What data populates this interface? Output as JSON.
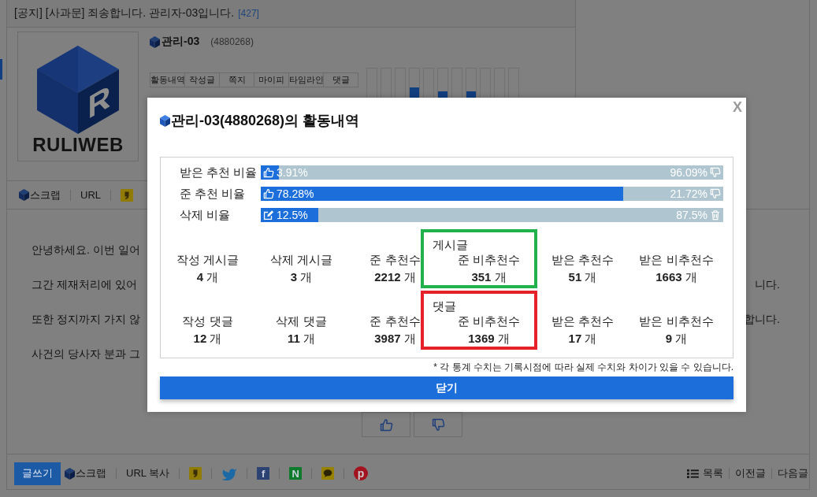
{
  "page": {
    "title": {
      "text": "[공지] [사과문] 죄송합니다. 관리자-03입니다.",
      "count": "[427]"
    },
    "profile": {
      "logo": {
        "mark": "R",
        "wordmark": "RULIWEB"
      },
      "name": "관리-03",
      "member_id": "(4880268)",
      "tabs": [
        {
          "label": "활동내역"
        },
        {
          "label": "작성글"
        },
        {
          "label": "쪽지"
        },
        {
          "label": "마이피"
        },
        {
          "label": "타임라인"
        },
        {
          "label": "댓글"
        }
      ]
    },
    "share_bar": [
      {
        "kind": "scrap",
        "label": "스크랩"
      },
      {
        "kind": "link",
        "label": "URL"
      },
      {
        "kind": "quote_tile",
        "color": "#8f7b05"
      }
    ],
    "body_lines": [
      {
        "left": "안녕하세요. 이번 일어"
      },
      {
        "left": "그간 제재처리에 있어",
        "right": "니다."
      },
      {
        "left": "또한 정지까지 가지 않",
        "right": "합니다."
      },
      {
        "left": "사건의 당사자 분과 그"
      }
    ],
    "vote_buttons": [
      {
        "kind": "up"
      },
      {
        "kind": "down"
      }
    ],
    "bottom_bar": {
      "write_button": "글쓰기",
      "share": [
        {
          "kind": "scrap",
          "label": "스크랩"
        },
        {
          "kind": "link",
          "label": "URL 복사"
        },
        {
          "kind": "quote_tile",
          "color": "#8f7b05"
        },
        {
          "kind": "bird",
          "color": "#1b6aa5"
        },
        {
          "kind": "letter_tile",
          "glyph": "f",
          "color": "#2c4272"
        },
        {
          "kind": "letter_tile",
          "glyph": "N",
          "color": "#0e7a2b"
        },
        {
          "kind": "bubble_tile",
          "color": "#968200"
        },
        {
          "kind": "letter_circle",
          "glyph": "p",
          "color": "#a2131f"
        }
      ],
      "nav": [
        {
          "kind": "list",
          "label": "목록"
        },
        {
          "kind": "link",
          "label": "이전글"
        },
        {
          "kind": "link",
          "label": "다음글"
        }
      ]
    }
  },
  "modal": {
    "title": "관리-03(4880268)의 활동내역",
    "close": "X",
    "bars": [
      {
        "kind": "vote",
        "label": "받은 추천 비율",
        "level": 0.0391,
        "left_text": "3.91%",
        "right_text": "96.09%"
      },
      {
        "kind": "vote",
        "label": "준 추천 비율",
        "level": 0.7828,
        "left_text": "78.28%",
        "right_text": "21.72%"
      },
      {
        "kind": "delete",
        "label": "삭제 비율",
        "level": 0.125,
        "left_text": "12.5%",
        "right_text": "87.5%"
      }
    ],
    "stat_rows": [
      {
        "group_label": "게시글",
        "color": "#21b24b",
        "items": [
          {
            "label": "작성 게시글",
            "value": "**4** 개",
            "highlighted": false
          },
          {
            "label": "삭제 게시글",
            "value": "**3** 개",
            "highlighted": false
          },
          {
            "label": "준 추천수",
            "value": "**2212** 개",
            "highlighted": false
          },
          {
            "label": "준 비추천수",
            "value": "**351** 개",
            "highlighted": true
          },
          {
            "label": "받은 추천수",
            "value": "**51** 개",
            "highlighted": false
          },
          {
            "label": "받은 비추천수",
            "value": "**1663** 개",
            "highlighted": false
          }
        ]
      },
      {
        "group_label": "댓글",
        "color": "#e52229",
        "items": [
          {
            "label": "작성 댓글",
            "value": "**12** 개",
            "highlighted": false
          },
          {
            "label": "삭제 댓글",
            "value": "**11** 개",
            "highlighted": false
          },
          {
            "label": "준 추천수",
            "value": "**3987** 개",
            "highlighted": false
          },
          {
            "label": "준 비추천수",
            "value": "**1369** 개",
            "highlighted": true
          },
          {
            "label": "받은 추천수",
            "value": "**17** 개",
            "highlighted": false
          },
          {
            "label": "받은 비추천수",
            "value": "**9** 개",
            "highlighted": false
          }
        ]
      }
    ],
    "note": "* 각 통계 수치는 기록시점에 따라 실제 수치와 차이가 있을 수 있습니다.",
    "close_button": "닫기"
  }
}
